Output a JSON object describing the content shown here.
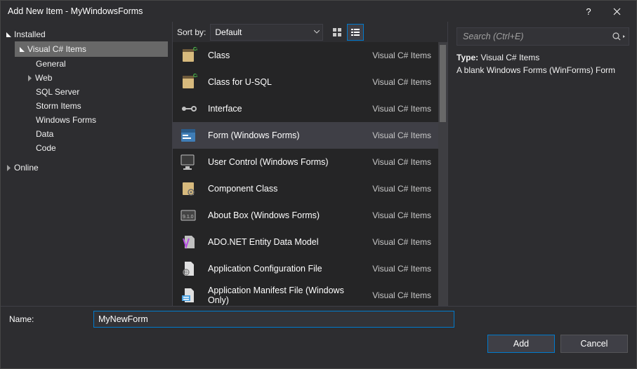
{
  "title": "Add New Item - MyWindowsForms",
  "tree": {
    "installed": "Installed",
    "csitems": "Visual C# Items",
    "children": [
      "General",
      "Web",
      "SQL Server",
      "Storm Items",
      "Windows Forms",
      "Data",
      "Code"
    ],
    "online": "Online"
  },
  "sort": {
    "label": "Sort by:",
    "value": "Default"
  },
  "items": [
    {
      "name": "Class",
      "cat": "Visual C# Items"
    },
    {
      "name": "Class for U-SQL",
      "cat": "Visual C# Items"
    },
    {
      "name": "Interface",
      "cat": "Visual C# Items"
    },
    {
      "name": "Form (Windows Forms)",
      "cat": "Visual C# Items"
    },
    {
      "name": "User Control (Windows Forms)",
      "cat": "Visual C# Items"
    },
    {
      "name": "Component Class",
      "cat": "Visual C# Items"
    },
    {
      "name": "About Box (Windows Forms)",
      "cat": "Visual C# Items"
    },
    {
      "name": "ADO.NET Entity Data Model",
      "cat": "Visual C# Items"
    },
    {
      "name": "Application Configuration File",
      "cat": "Visual C# Items"
    },
    {
      "name": "Application Manifest File (Windows Only)",
      "cat": "Visual C# Items"
    }
  ],
  "selectedItemIndex": 3,
  "search": {
    "placeholder": "Search (Ctrl+E)"
  },
  "details": {
    "typeLabel": "Type:",
    "typeValue": "Visual C# Items",
    "desc": "A blank Windows Forms (WinForms) Form"
  },
  "nameField": {
    "label": "Name:",
    "value": "MyNewForm"
  },
  "buttons": {
    "add": "Add",
    "cancel": "Cancel"
  }
}
